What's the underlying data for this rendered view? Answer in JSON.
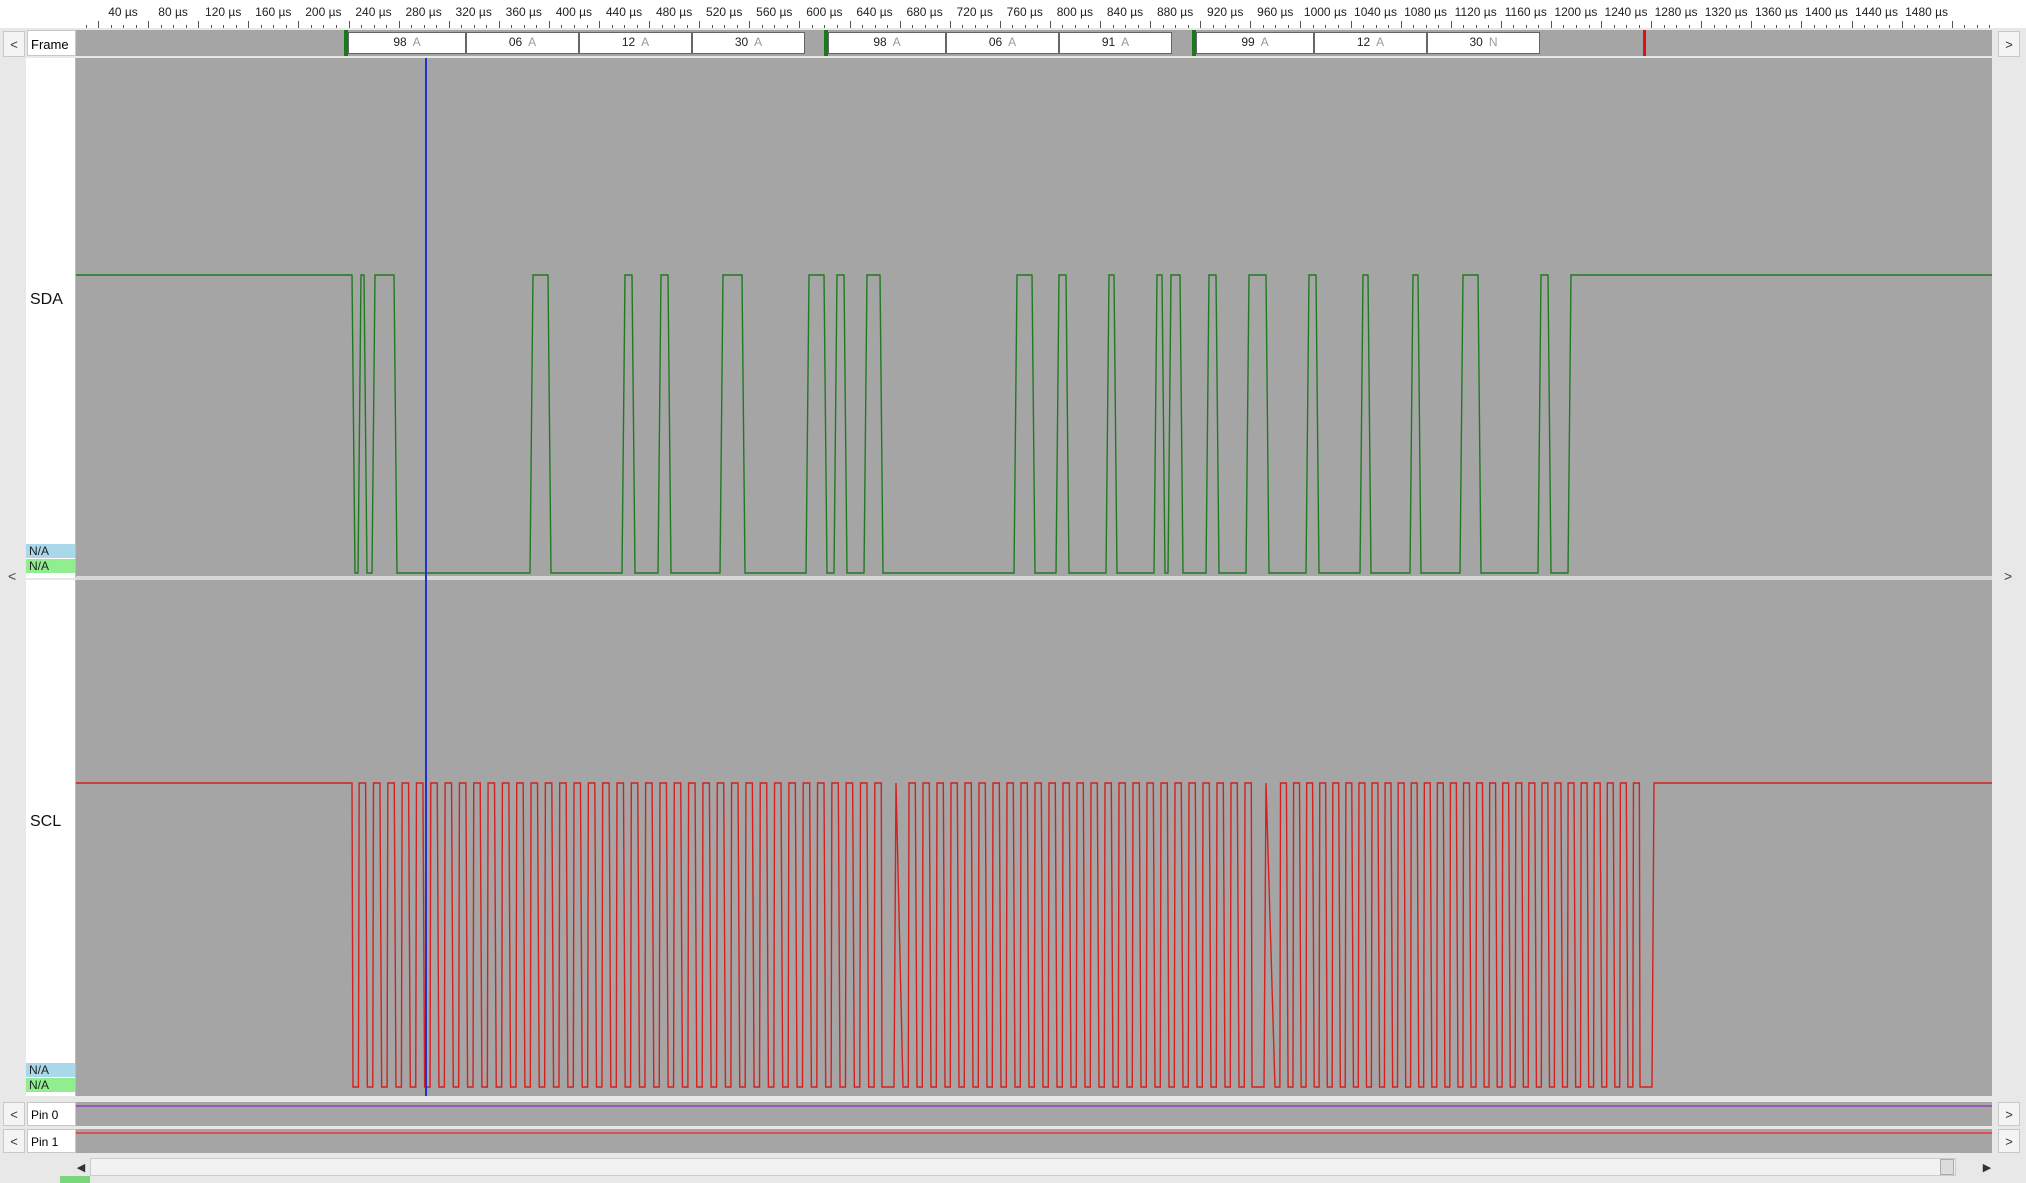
{
  "ruler": {
    "ticks": [
      "40 µs",
      "80 µs",
      "120 µs",
      "160 µs",
      "200 µs",
      "240 µs",
      "280 µs",
      "320 µs",
      "360 µs",
      "400 µs",
      "440 µs",
      "480 µs",
      "520 µs",
      "560 µs",
      "600 µs",
      "640 µs",
      "680 µs",
      "720 µs",
      "760 µs",
      "800 µs",
      "840 µs",
      "880 µs",
      "920 µs",
      "960 µs",
      "1000 µs",
      "1040 µs",
      "1080 µs",
      "1120 µs",
      "1160 µs",
      "1200 µs",
      "1240 µs",
      "1280 µs",
      "1320 µs",
      "1360 µs",
      "1400 µs",
      "1440 µs",
      "1480 µs"
    ]
  },
  "frame_row": {
    "label": "Frame",
    "left_arrow": "<",
    "right_arrow": ">",
    "frames": [
      {
        "bytes": [
          {
            "value": "98",
            "ack": "A"
          },
          {
            "value": "06",
            "ack": "A"
          },
          {
            "value": "12",
            "ack": "A"
          },
          {
            "value": "30",
            "ack": "A"
          }
        ]
      },
      {
        "bytes": [
          {
            "value": "98",
            "ack": "A"
          },
          {
            "value": "06",
            "ack": "A"
          },
          {
            "value": "91",
            "ack": "A"
          }
        ]
      },
      {
        "bytes": [
          {
            "value": "99",
            "ack": "A"
          },
          {
            "value": "12",
            "ack": "A"
          },
          {
            "value": "30",
            "ack": "N"
          }
        ]
      }
    ]
  },
  "channels": [
    {
      "name": "SDA",
      "na_top": "N/A",
      "na_bottom": "N/A",
      "color": "#1f7a1f"
    },
    {
      "name": "SCL",
      "na_top": "N/A",
      "na_bottom": "N/A",
      "color": "#d42020"
    }
  ],
  "side_arrows": {
    "left": "<",
    "right": ">"
  },
  "pins": [
    {
      "label": "Pin 0",
      "color": "#9b59b6"
    },
    {
      "label": "Pin 1",
      "color": "#e05050"
    }
  ],
  "scrollbar": {
    "left": "◀",
    "right": "▶"
  },
  "colors": {
    "cursor": "#2233cc",
    "plot_bg": "#a5a5a5"
  }
}
